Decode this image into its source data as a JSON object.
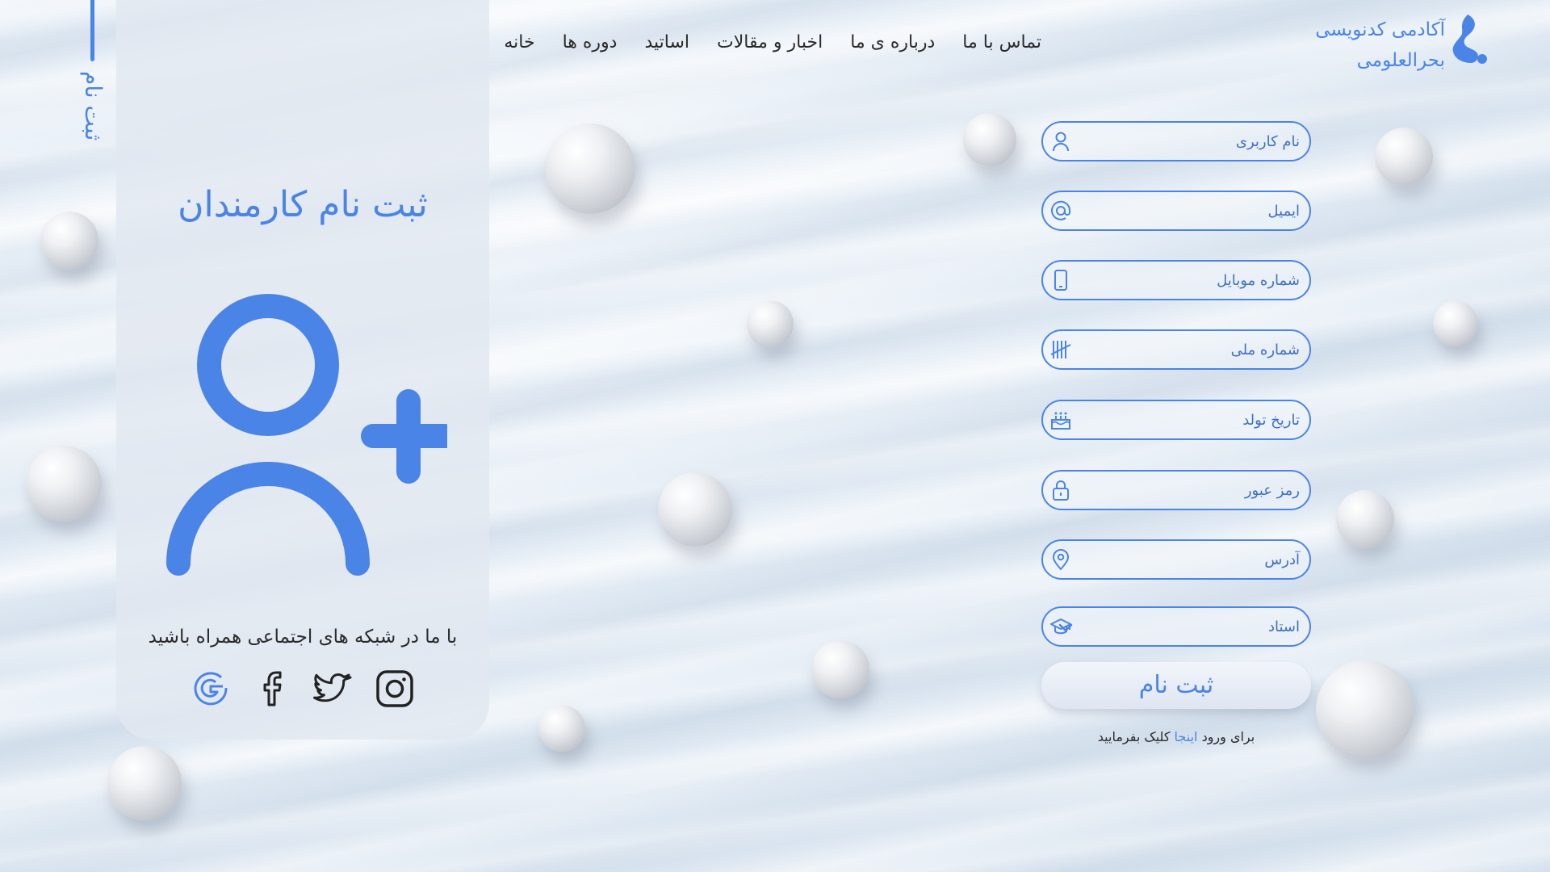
{
  "brand": {
    "line1": "آکادمی کدنویسی",
    "line2": "بحرالعلومی",
    "accent_color": "#4a84e6"
  },
  "nav": {
    "items": [
      {
        "label": "خانه"
      },
      {
        "label": "دوره ها"
      },
      {
        "label": "اساتید"
      },
      {
        "label": "اخبار و مقالات"
      },
      {
        "label": "درباره ی ما"
      },
      {
        "label": "تماس با ما"
      }
    ]
  },
  "side_tab": {
    "label": "ثبت نام"
  },
  "left_panel": {
    "title": "ثبت نام کارمندان",
    "icon": "user-plus-icon",
    "social_text": "با ما در شبکه های اجتماعی همراه باشید",
    "socials": [
      {
        "name": "instagram-icon"
      },
      {
        "name": "twitter-icon"
      },
      {
        "name": "facebook-icon"
      },
      {
        "name": "google-icon"
      }
    ]
  },
  "form": {
    "fields": [
      {
        "placeholder": "نام کاربری",
        "icon": "user-icon"
      },
      {
        "placeholder": "ایمیل",
        "icon": "at-icon"
      },
      {
        "placeholder": "شماره موبایل",
        "icon": "mobile-icon"
      },
      {
        "placeholder": "شماره ملی",
        "icon": "tally-icon"
      },
      {
        "placeholder": "تاریخ تولد",
        "icon": "cake-icon"
      },
      {
        "placeholder": "رمز عبور",
        "icon": "lock-icon"
      },
      {
        "placeholder": "آدرس",
        "icon": "location-pin-icon"
      }
    ],
    "role_select": {
      "value": "استاد",
      "icon": "graduation-cap-icon"
    },
    "submit_label": "ثبت نام",
    "login_hint": {
      "before": "برای ورود",
      "link": "اینجا",
      "after": "کلیک بفرمایید"
    }
  }
}
